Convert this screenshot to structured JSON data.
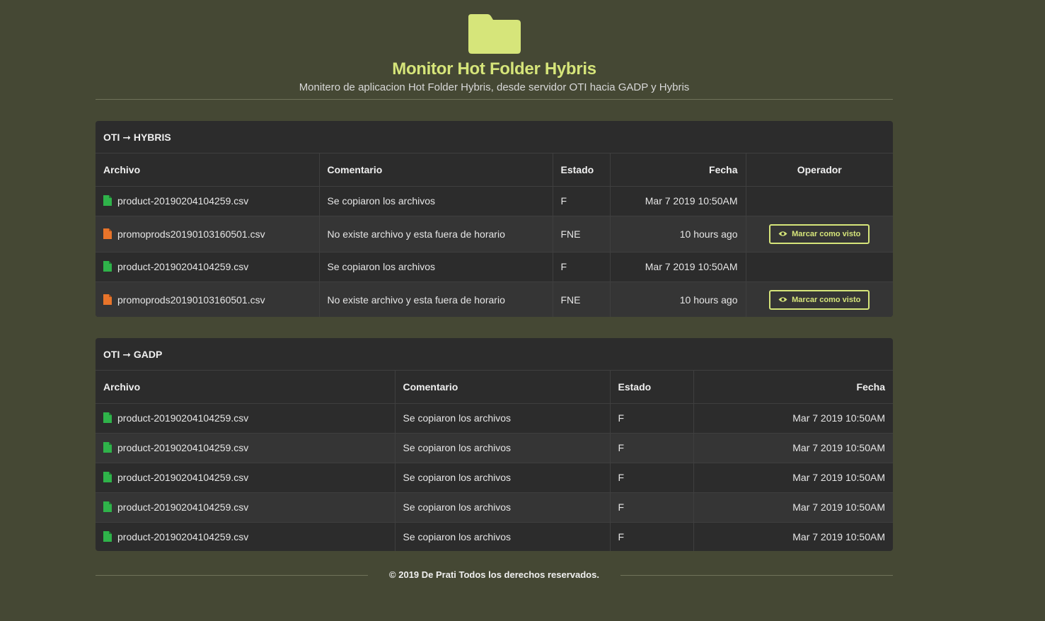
{
  "header": {
    "icon": "folder-icon",
    "title": "Monitor Hot Folder Hybris",
    "subtitle": "Monitero de aplicacion Hot Folder Hybris, desde servidor OTI hacia GADP y Hybris"
  },
  "colors": {
    "background": "#454834",
    "accent": "#d6e57a",
    "panel": "#2c2c2c",
    "file_ok": "#2fb34a",
    "file_warn": "#e8742a"
  },
  "hybris": {
    "title": "OTI ➞ HYBRIS",
    "columns": [
      "Archivo",
      "Comentario",
      "Estado",
      "Fecha",
      "Operador"
    ],
    "rows": [
      {
        "file": "product-20190204104259.csv",
        "comment": "Se copiaron los archivos",
        "status": "F",
        "date": "Mar 7 2019 10:50AM",
        "icon": "file-ok-icon",
        "action": ""
      },
      {
        "file": "promoprods20190103160501.csv",
        "comment": "No existe archivo y esta fuera de horario",
        "status": "FNE",
        "date": "10 hours ago",
        "icon": "file-warning-icon",
        "action": "Marcar como visto"
      },
      {
        "file": "product-20190204104259.csv",
        "comment": "Se copiaron los archivos",
        "status": "F",
        "date": "Mar 7 2019 10:50AM",
        "icon": "file-ok-icon",
        "action": ""
      },
      {
        "file": "promoprods20190103160501.csv",
        "comment": "No existe archivo y esta fuera de horario",
        "status": "FNE",
        "date": "10 hours ago",
        "icon": "file-warning-icon",
        "action": "Marcar como visto"
      }
    ]
  },
  "gadp": {
    "title": "OTI ➞ GADP",
    "columns": [
      "Archivo",
      "Comentario",
      "Estado",
      "Fecha"
    ],
    "rows": [
      {
        "file": "product-20190204104259.csv",
        "comment": "Se copiaron los archivos",
        "status": "F",
        "date": "Mar 7 2019 10:50AM",
        "icon": "file-ok-icon"
      },
      {
        "file": "product-20190204104259.csv",
        "comment": "Se copiaron los archivos",
        "status": "F",
        "date": "Mar 7 2019 10:50AM",
        "icon": "file-ok-icon"
      },
      {
        "file": "product-20190204104259.csv",
        "comment": "Se copiaron los archivos",
        "status": "F",
        "date": "Mar 7 2019 10:50AM",
        "icon": "file-ok-icon"
      },
      {
        "file": "product-20190204104259.csv",
        "comment": "Se copiaron los archivos",
        "status": "F",
        "date": "Mar 7 2019 10:50AM",
        "icon": "file-ok-icon"
      },
      {
        "file": "product-20190204104259.csv",
        "comment": "Se copiaron los archivos",
        "status": "F",
        "date": "Mar 7 2019 10:50AM",
        "icon": "file-ok-icon"
      }
    ]
  },
  "footer": {
    "text": "© 2019 De Prati Todos los derechos reservados."
  }
}
